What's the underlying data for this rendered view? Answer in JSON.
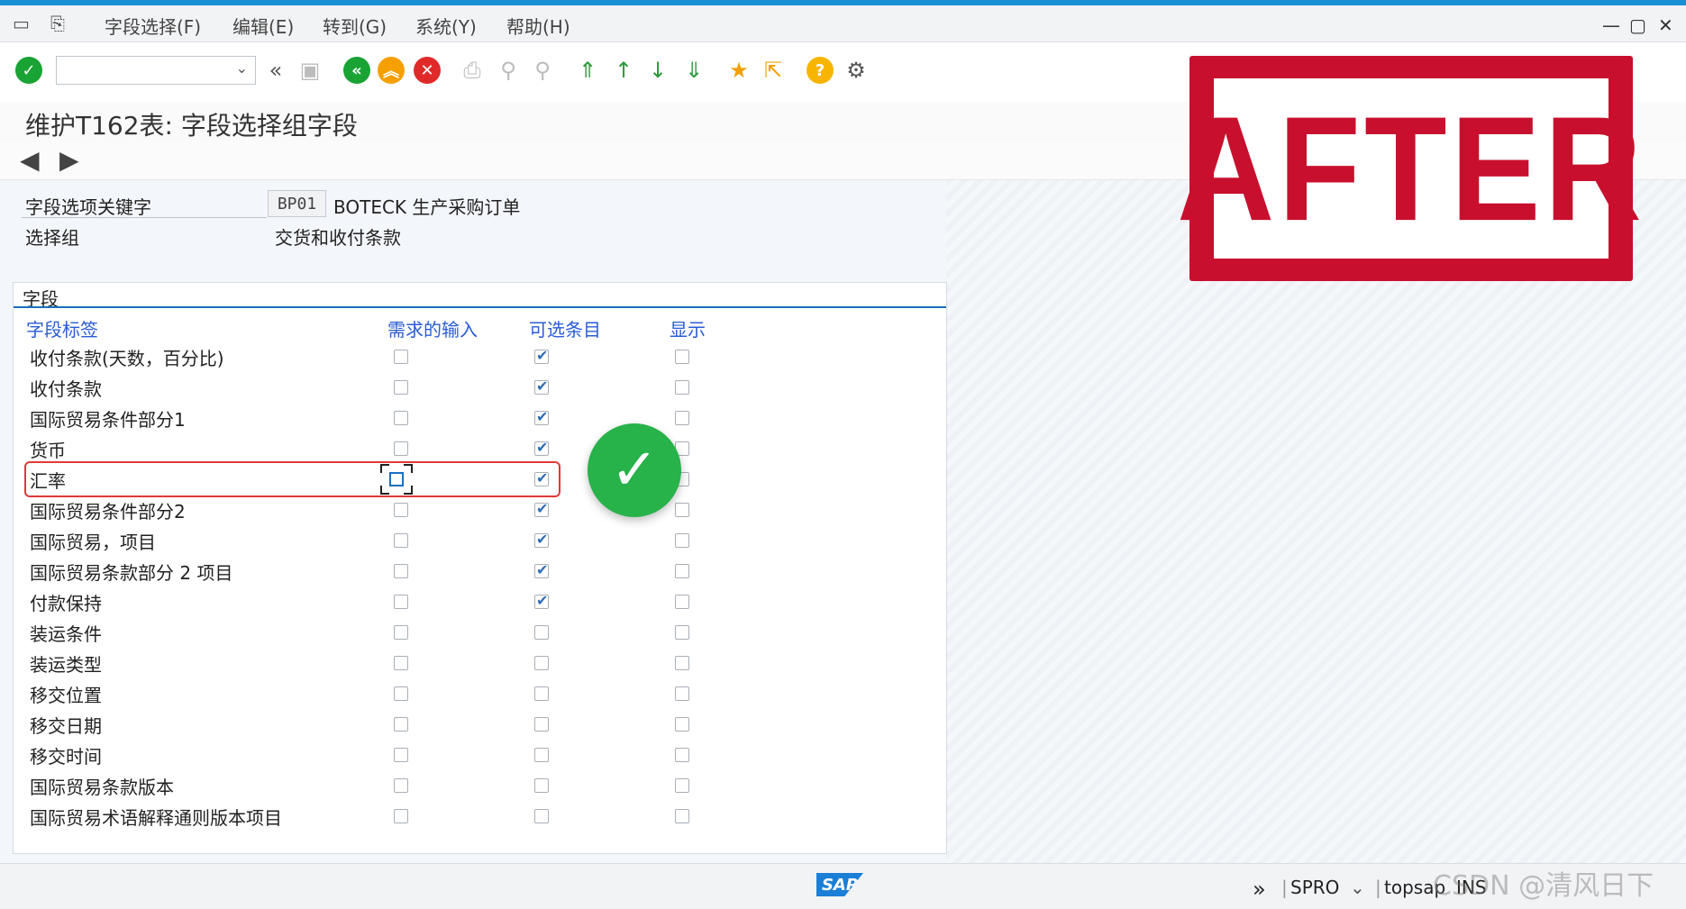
{
  "menu": {
    "items": [
      "字段选择(F)",
      "编辑(E)",
      "转到(G)",
      "系统(Y)",
      "帮助(H)"
    ]
  },
  "toolbar": {
    "command_value": "",
    "icons": [
      "enter-icon",
      "back-icon",
      "save-icon",
      "back-green-icon",
      "exit-icon",
      "cancel-icon",
      "print-icon",
      "find-icon",
      "find-next-icon",
      "first-page-icon",
      "prev-page-icon",
      "next-page-icon",
      "last-page-icon",
      "create-session-icon",
      "shortcut-icon",
      "help-icon",
      "settings-icon"
    ]
  },
  "title": "维护T162表: 字段选择组字段",
  "header": {
    "key_label": "字段选项关键字",
    "key_value": "BP01",
    "key_desc": "BOTECK 生产采购订单",
    "group_label": "选择组",
    "group_value": "交货和收付条款"
  },
  "group": {
    "title": "字段",
    "columns": [
      "字段标签",
      "需求的输入",
      "可选条目",
      "显示"
    ],
    "rows": [
      {
        "label": "收付条款(天数，百分比)",
        "required": false,
        "optional": true,
        "display": false
      },
      {
        "label": "收付条款",
        "required": false,
        "optional": true,
        "display": false
      },
      {
        "label": "国际贸易条件部分1",
        "required": false,
        "optional": true,
        "display": false
      },
      {
        "label": "货币",
        "required": false,
        "optional": true,
        "display": false
      },
      {
        "label": "汇率",
        "required": false,
        "optional": true,
        "display": false
      },
      {
        "label": "国际贸易条件部分2",
        "required": false,
        "optional": true,
        "display": false
      },
      {
        "label": "国际贸易，项目",
        "required": false,
        "optional": true,
        "display": false
      },
      {
        "label": "国际贸易条款部分 2 项目",
        "required": false,
        "optional": true,
        "display": false
      },
      {
        "label": "付款保持",
        "required": false,
        "optional": true,
        "display": false
      },
      {
        "label": "装运条件",
        "required": false,
        "optional": false,
        "display": false
      },
      {
        "label": "装运类型",
        "required": false,
        "optional": false,
        "display": false
      },
      {
        "label": "移交位置",
        "required": false,
        "optional": false,
        "display": false
      },
      {
        "label": "移交日期",
        "required": false,
        "optional": false,
        "display": false
      },
      {
        "label": "移交时间",
        "required": false,
        "optional": false,
        "display": false
      },
      {
        "label": "国际贸易条款版本",
        "required": false,
        "optional": false,
        "display": false
      },
      {
        "label": "国际贸易术语解释通则版本项目",
        "required": false,
        "optional": false,
        "display": false
      }
    ]
  },
  "stamp": {
    "text": "AFTER"
  },
  "status": {
    "logo": "SAP",
    "transaction": "SPRO",
    "system": "topsap",
    "mode": "INS"
  },
  "watermark": "CSDN @清风日下",
  "colors": {
    "accent": "#1a8fd6",
    "stamp": "#c8102e",
    "check": "#27b24a",
    "highlight": "#e23838"
  }
}
